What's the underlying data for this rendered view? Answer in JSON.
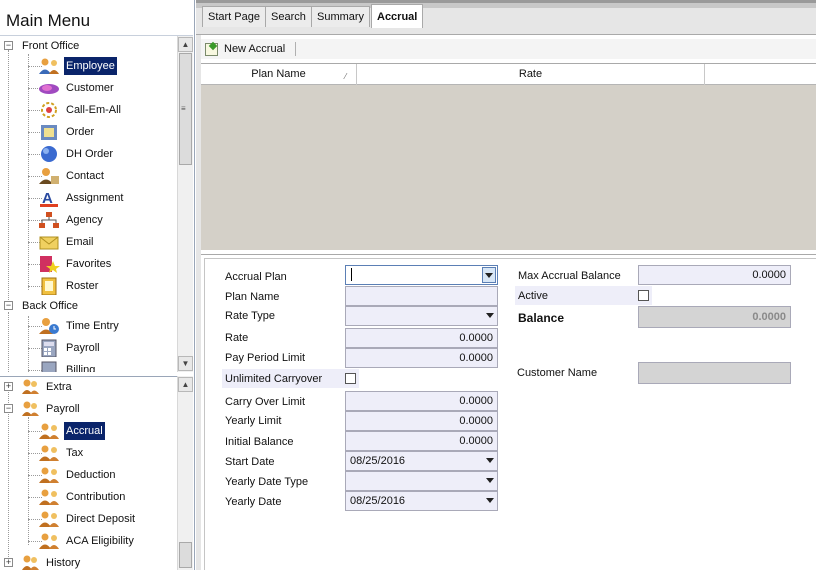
{
  "menu": {
    "title": "Main Menu",
    "front_office": "Front Office",
    "back_office": "Back Office",
    "top_items": [
      {
        "label": "Employee",
        "icon": "employee-icon"
      },
      {
        "label": "Customer",
        "icon": "customer-icon"
      },
      {
        "label": "Call-Em-All",
        "icon": "call-em-all-icon"
      },
      {
        "label": "Order",
        "icon": "order-icon"
      },
      {
        "label": "DH Order",
        "icon": "dh-order-icon"
      },
      {
        "label": "Contact",
        "icon": "contact-icon"
      },
      {
        "label": "Assignment",
        "icon": "assignment-icon"
      },
      {
        "label": "Agency",
        "icon": "agency-icon"
      },
      {
        "label": "Email",
        "icon": "email-icon"
      },
      {
        "label": "Favorites",
        "icon": "favorites-icon"
      },
      {
        "label": "Roster",
        "icon": "roster-icon"
      }
    ],
    "back_items": [
      {
        "label": "Time Entry",
        "icon": "time-entry-icon"
      },
      {
        "label": "Payroll",
        "icon": "payroll-icon"
      },
      {
        "label": "Billing",
        "icon": "billing-icon"
      }
    ],
    "bottom": {
      "extra": "Extra",
      "payroll": "Payroll",
      "history": "History",
      "payroll_items": [
        "Accrual",
        "Tax",
        "Deduction",
        "Contribution",
        "Direct Deposit",
        "ACA Eligibility"
      ]
    }
  },
  "tabs": [
    "Start Page",
    "Search",
    "Summary",
    "Accrual"
  ],
  "toolbar": {
    "new_accrual": "New Accrual"
  },
  "grid": {
    "columns": [
      "Plan Name",
      "Rate"
    ]
  },
  "form": {
    "accrual_plan_label": "Accrual Plan",
    "accrual_plan_value": "",
    "plan_name_label": "Plan Name",
    "rate_type_label": "Rate Type",
    "rate_label": "Rate",
    "rate_value": "0.0000",
    "pay_period_limit_label": "Pay Period Limit",
    "pay_period_limit_value": "0.0000",
    "unlimited_carryover_label": "Unlimited Carryover",
    "carry_over_limit_label": "Carry Over Limit",
    "carry_over_limit_value": "0.0000",
    "yearly_limit_label": "Yearly Limit",
    "yearly_limit_value": "0.0000",
    "initial_balance_label": "Initial Balance",
    "initial_balance_value": "0.0000",
    "start_date_label": "Start Date",
    "start_date_value": "08/25/2016",
    "yearly_date_type_label": "Yearly Date Type",
    "yearly_date_label": "Yearly Date",
    "yearly_date_value": "08/25/2016",
    "max_accrual_balance_label": "Max Accrual Balance",
    "max_accrual_balance_value": "0.0000",
    "active_label": "Active",
    "balance_label": "Balance",
    "balance_value": "0.0000",
    "customer_name_label": "Customer Name"
  },
  "colors": {
    "selection": "#0a246a",
    "field_bg": "#eeeef9",
    "grid_bg": "#d4d0c8"
  }
}
